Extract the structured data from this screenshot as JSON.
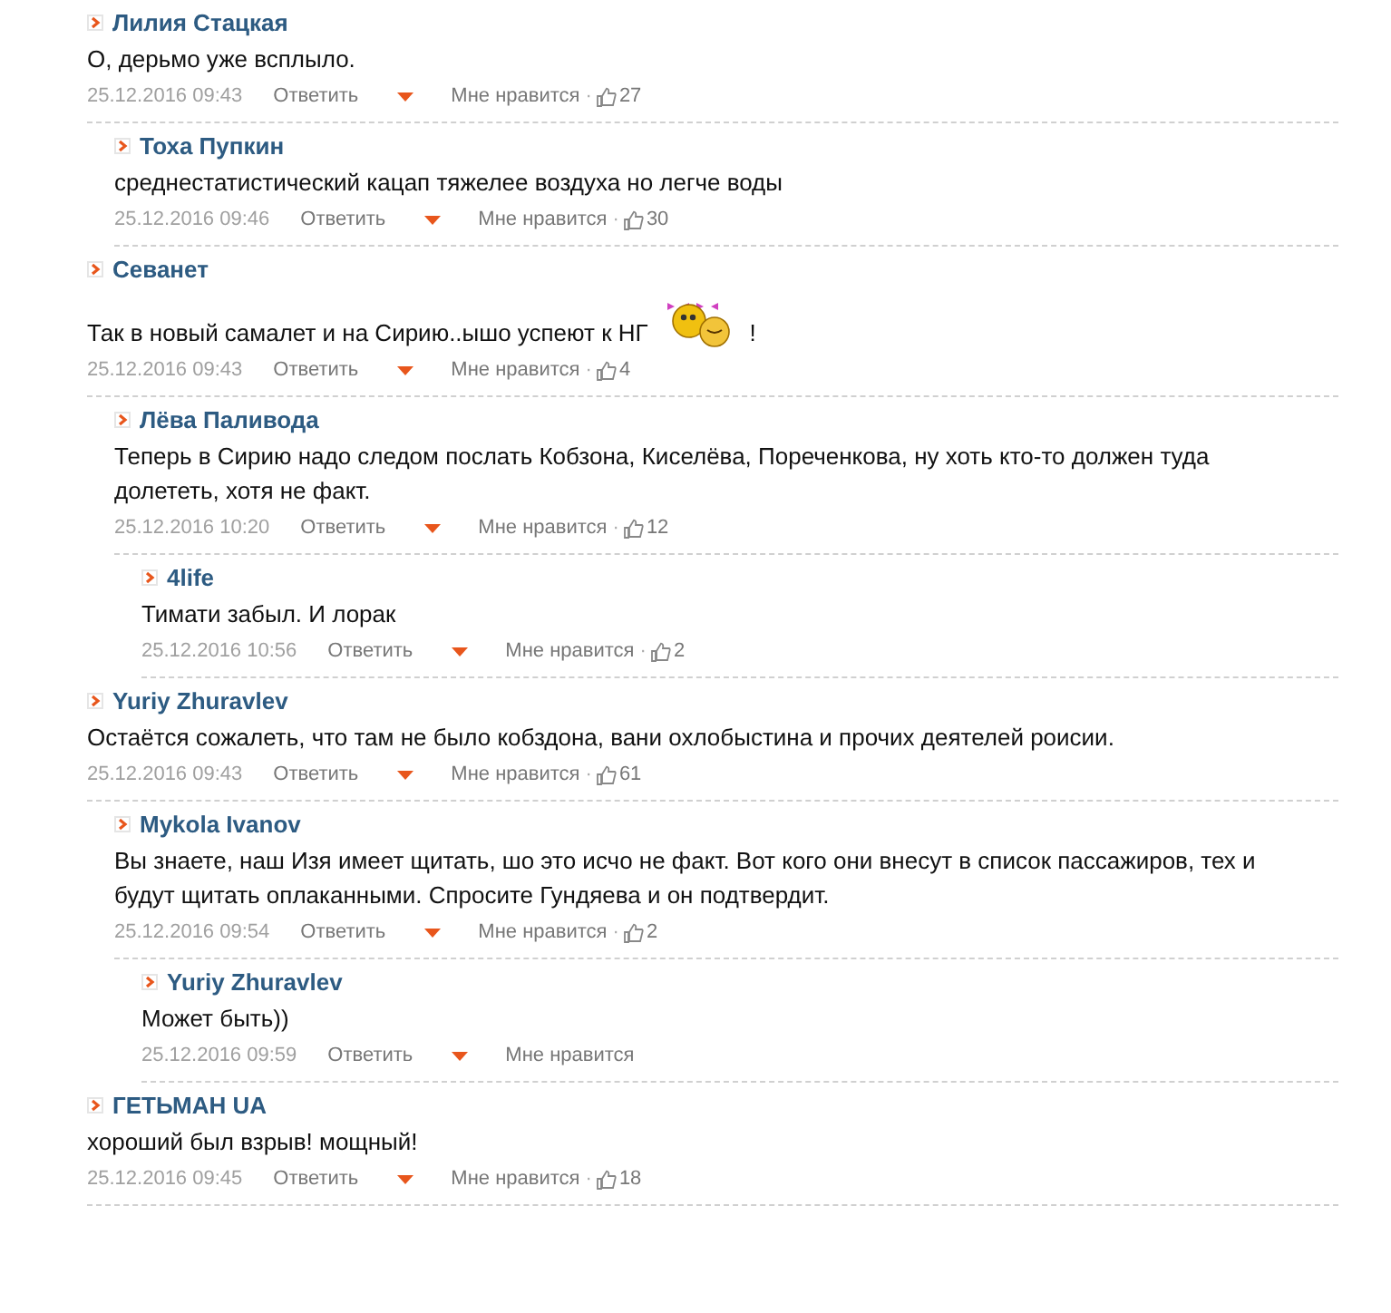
{
  "comments": [
    {
      "author": "Лилия Стацкая",
      "body": "О, дерьмо уже всплыло.",
      "date": "25.12.2016 09:43",
      "reply": "Ответить",
      "like": "Мне нравится",
      "dot": "·",
      "likes": "27",
      "children": [
        {
          "author": "Тоха Пупкин",
          "body": "среднестатистический кацап тяжелее воздуха но легче воды",
          "date": "25.12.2016 09:46",
          "reply": "Ответить",
          "like": "Мне нравится",
          "dot": "·",
          "likes": "30"
        }
      ]
    },
    {
      "author": "Севанет",
      "body": "Так в новый самалет и на Сирию..ышо успеют к НГ",
      "emoticon": true,
      "body_end": "!",
      "date": "25.12.2016 09:43",
      "reply": "Ответить",
      "like": "Мне нравится",
      "dot": "·",
      "likes": "4",
      "children": [
        {
          "author": "Лёва Паливода",
          "body": "Теперь в Сирию надо следом послать Кобзона, Киселёва, Пореченкова, ну хоть кто-то должен туда долететь, хотя не факт.",
          "date": "25.12.2016 10:20",
          "reply": "Ответить",
          "like": "Мне нравится",
          "dot": "·",
          "likes": "12",
          "children": [
            {
              "author": "4life",
              "body": "Тимати забыл. И лорак",
              "date": "25.12.2016 10:56",
              "reply": "Ответить",
              "like": "Мне нравится",
              "dot": "·",
              "likes": "2"
            }
          ]
        }
      ]
    },
    {
      "author": "Yuriy Zhuravlev",
      "body": "Остаётся сожалеть, что там не было кобздона, вани охлобыстина и прочих деятелей роисии.",
      "date": "25.12.2016 09:43",
      "reply": "Ответить",
      "like": "Мне нравится",
      "dot": "·",
      "likes": "61",
      "children": [
        {
          "author": "Mykola Ivanov",
          "body": "Вы знаете, наш Изя имеет щитать, шо это исчо не факт. Вот кого они внесут в список пассажиров, тех и будут щитать оплаканными. Спросите Гундяева и он подтвердит.",
          "date": "25.12.2016 09:54",
          "reply": "Ответить",
          "like": "Мне нравится",
          "dot": "·",
          "likes": "2",
          "children": [
            {
              "author": "Yuriy Zhuravlev",
              "body": "Может быть))",
              "date": "25.12.2016 09:59",
              "reply": "Ответить",
              "like": "Мне нравится"
            }
          ]
        }
      ]
    },
    {
      "author": "ГЕТЬМАН UA",
      "body": "хороший был взрыв! мощный!",
      "date": "25.12.2016 09:45",
      "reply": "Ответить",
      "like": "Мне нравится",
      "dot": "·",
      "likes": "18"
    }
  ]
}
